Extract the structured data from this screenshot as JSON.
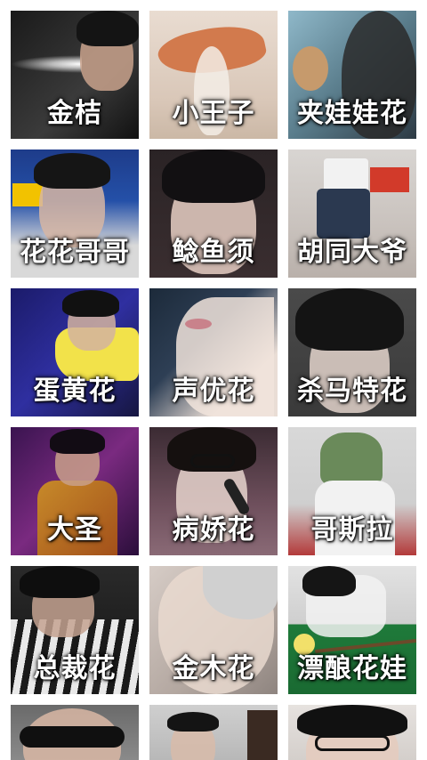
{
  "tiles": [
    {
      "caption": "金桔"
    },
    {
      "caption": "小王子"
    },
    {
      "caption": "夹娃娃花"
    },
    {
      "caption": "花花哥哥"
    },
    {
      "caption": "鲶鱼须"
    },
    {
      "caption": "胡同大爷"
    },
    {
      "caption": "蛋黄花"
    },
    {
      "caption": "声优花"
    },
    {
      "caption": "杀马特花"
    },
    {
      "caption": "大圣"
    },
    {
      "caption": "病娇花"
    },
    {
      "caption": "哥斯拉"
    },
    {
      "caption": "总裁花"
    },
    {
      "caption": "金木花"
    },
    {
      "caption": "漂酿花娃"
    }
  ]
}
